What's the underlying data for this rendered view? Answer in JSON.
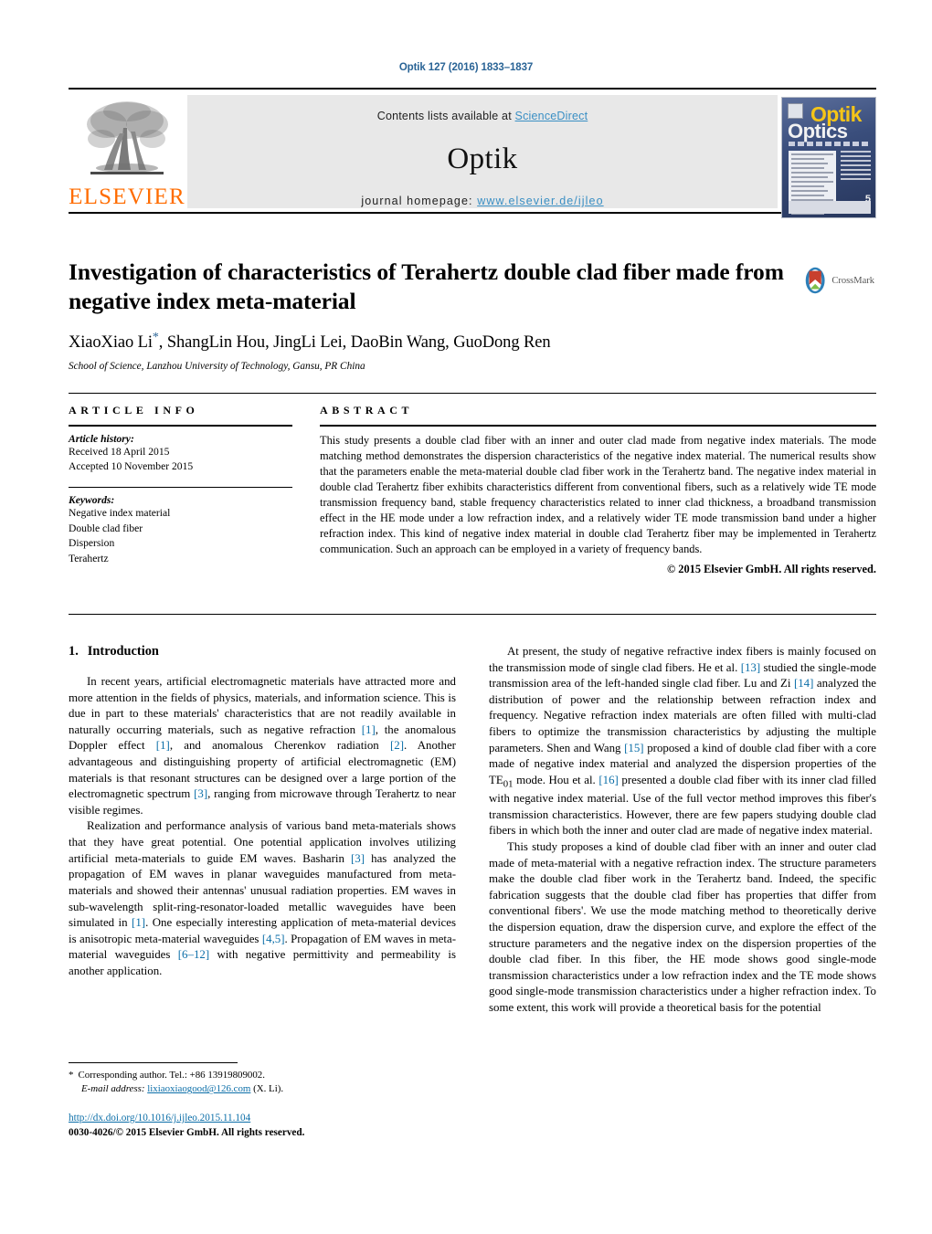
{
  "running_head": "Optik 127 (2016) 1833–1837",
  "masthead": {
    "publisher": "ELSEVIER",
    "contents_prefix": "Contents lists available at ",
    "contents_link": "ScienceDirect",
    "journal_title": "Optik",
    "homepage_prefix": "journal homepage: ",
    "homepage_url": "www.elsevier.de/ijleo",
    "cover": {
      "title_top": "Optik",
      "title_bottom": "Optics",
      "issue_number": "5"
    }
  },
  "title_block": {
    "title": "Investigation of characteristics of Terahertz double clad fiber made from negative index meta-material",
    "authors_before_star": "XiaoXiao Li",
    "corresponding_star": "*",
    "authors_after_star": ", ShangLin Hou, JingLi Lei, DaoBin Wang, GuoDong Ren",
    "affiliation": "School of Science, Lanzhou University of Technology, Gansu, PR China",
    "crossmark_label": "CrossMark"
  },
  "article_info": {
    "heading": "ARTICLE INFO",
    "history_label": "Article history:",
    "received": "Received 18 April 2015",
    "accepted": "Accepted 10 November 2015",
    "keywords_label": "Keywords:",
    "keywords": [
      "Negative index material",
      "Double clad fiber",
      "Dispersion",
      "Terahertz"
    ]
  },
  "abstract": {
    "heading": "ABSTRACT",
    "text": "This study presents a double clad fiber with an inner and outer clad made from negative index materials. The mode matching method demonstrates the dispersion characteristics of the negative index material. The numerical results show that the parameters enable the meta-material double clad fiber work in the Terahertz band. The negative index material in double clad Terahertz fiber exhibits characteristics different from conventional fibers, such as a relatively wide TE mode transmission frequency band, stable frequency characteristics related to inner clad thickness, a broadband transmission effect in the HE mode under a low refraction index, and a relatively wider TE mode transmission band under a higher refraction index. This kind of negative index material in double clad Terahertz fiber may be implemented in Terahertz communication. Such an approach can be employed in a variety of frequency bands.",
    "copyright": "© 2015 Elsevier GmbH. All rights reserved."
  },
  "body": {
    "section_number": "1.",
    "section_title": "Introduction",
    "left_paragraphs": [
      "In recent years, artificial electromagnetic materials have attracted more and more attention in the fields of physics, materials, and information science. This is due in part to these materials' characteristics that are not readily available in naturally occurring materials, such as negative refraction [1], the anomalous Doppler effect [1], and anomalous Cherenkov radiation [2]. Another advantageous and distinguishing property of artificial electromagnetic (EM) materials is that resonant structures can be designed over a large portion of the electromagnetic spectrum [3], ranging from microwave through Terahertz to near visible regimes.",
      "Realization and performance analysis of various band meta-materials shows that they have great potential. One potential application involves utilizing artificial meta-materials to guide EM waves. Basharin [3] has analyzed the propagation of EM waves in planar waveguides manufactured from meta-materials and showed their antennas' unusual radiation properties. EM waves in sub-wavelength split-ring-resonator-loaded metallic waveguides have been simulated in [1]. One especially interesting application of meta-material devices is anisotropic meta-material waveguides [4,5]. Propagation of EM waves in meta-material waveguides [6–12] with negative permittivity and permeability is another application."
    ],
    "right_paragraphs": [
      "At present, the study of negative refractive index fibers is mainly focused on the transmission mode of single clad fibers. He et al. [13] studied the single-mode transmission area of the left-handed single clad fiber. Lu and Zi [14] analyzed the distribution of power and the relationship between refraction index and frequency. Negative refraction index materials are often filled with multi-clad fibers to optimize the transmission characteristics by adjusting the multiple parameters. Shen and Wang [15] proposed a kind of double clad fiber with a core made of negative index material and analyzed the dispersion properties of the TE01 mode. Hou et al. [16] presented a double clad fiber with its inner clad filled with negative index material. Use of the full vector method improves this fiber's transmission characteristics. However, there are few papers studying double clad fibers in which both the inner and outer clad are made of negative index material.",
      "This study proposes a kind of double clad fiber with an inner and outer clad made of meta-material with a negative refraction index. The structure parameters make the double clad fiber work in the Terahertz band. Indeed, the specific fabrication suggests that the double clad fiber has properties that differ from conventional fibers'. We use the mode matching method to theoretically derive the dispersion equation, draw the dispersion curve, and explore the effect of the structure parameters and the negative index on the dispersion properties of the double clad fiber. In this fiber, the HE mode shows good single-mode transmission characteristics under a low refraction index and the TE mode shows good single-mode transmission characteristics under a higher refraction index. To some extent, this work will provide a theoretical basis for the potential"
    ]
  },
  "footnotes": {
    "star": "*",
    "corresponding": "Corresponding author. Tel.: +86 13919809002.",
    "email_label": "E-mail address:",
    "email": "lixiaoxiaogood@126.com",
    "email_suffix": "(X. Li).",
    "doi": "http://dx.doi.org/10.1016/j.ijleo.2015.11.104",
    "issn_line": "0030-4026/© 2015 Elsevier GmbH. All rights reserved."
  },
  "colors": {
    "link": "#0b6ea8",
    "elsevier_orange": "#ff6c00",
    "sciencedirect_blue": "#3a8fc4"
  }
}
